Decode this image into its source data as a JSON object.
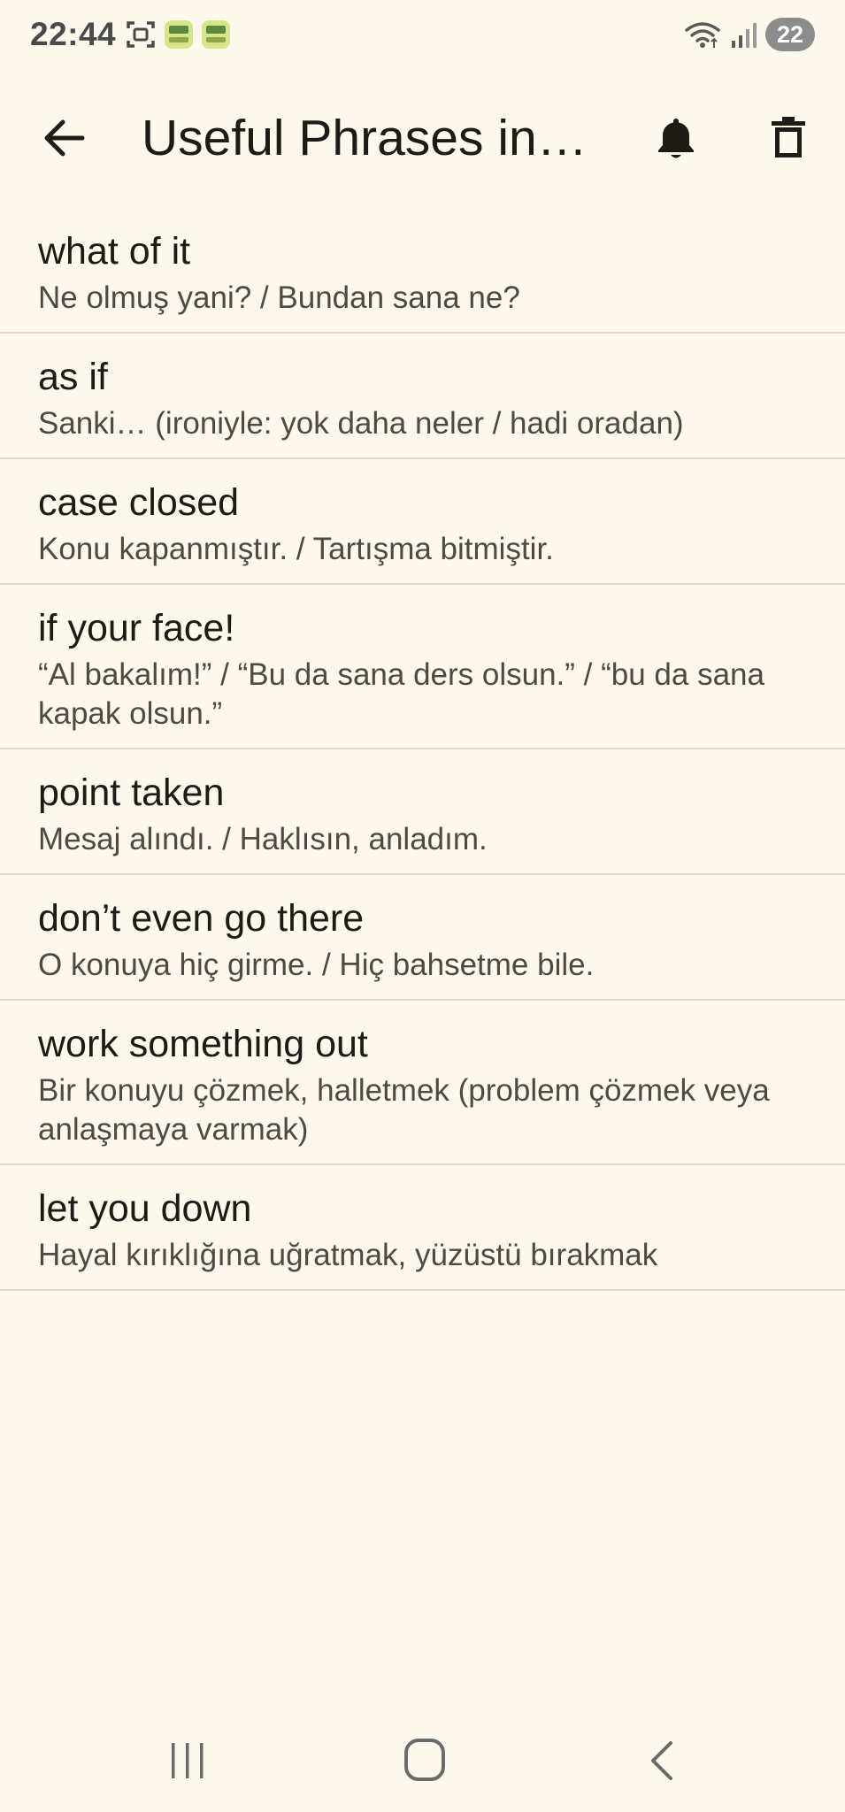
{
  "status_bar": {
    "time": "22:44",
    "battery": "22",
    "icons": [
      "screen-capture-icon",
      "app-notification-icon",
      "app-notification-icon",
      "wifi-icon",
      "signal-icon"
    ]
  },
  "app_bar": {
    "title": "Useful Phrases in…",
    "back_icon": "arrow-back-icon",
    "bell_icon": "bell-icon",
    "delete_icon": "trash-icon"
  },
  "phrases": [
    {
      "term": "what of it",
      "translation": "Ne olmuş yani? / Bundan sana ne?"
    },
    {
      "term": "as if",
      "translation": "Sanki… (ironiyle: yok daha neler / hadi oradan)"
    },
    {
      "term": "case closed",
      "translation": "Konu kapanmıştır. / Tartışma bitmiştir."
    },
    {
      "term": "if your face!",
      "translation": "“Al bakalım!” / “Bu da sana ders olsun.” / “bu da sana kapak olsun.”"
    },
    {
      "term": "point taken",
      "translation": "Mesaj alındı. / Haklısın, anladım."
    },
    {
      "term": "don’t even go there",
      "translation": "O konuya hiç girme. / Hiç bahsetme bile."
    },
    {
      "term": "work something out",
      "translation": "Bir konuyu çözmek, halletmek (problem çözmek veya anlaşmaya varmak)"
    },
    {
      "term": "let you down",
      "translation": "Hayal kırıklığına uğratmak, yüzüstü bırakmak"
    }
  ],
  "nav_bar": {
    "icons": [
      "recents-icon",
      "home-icon",
      "back-icon"
    ]
  }
}
